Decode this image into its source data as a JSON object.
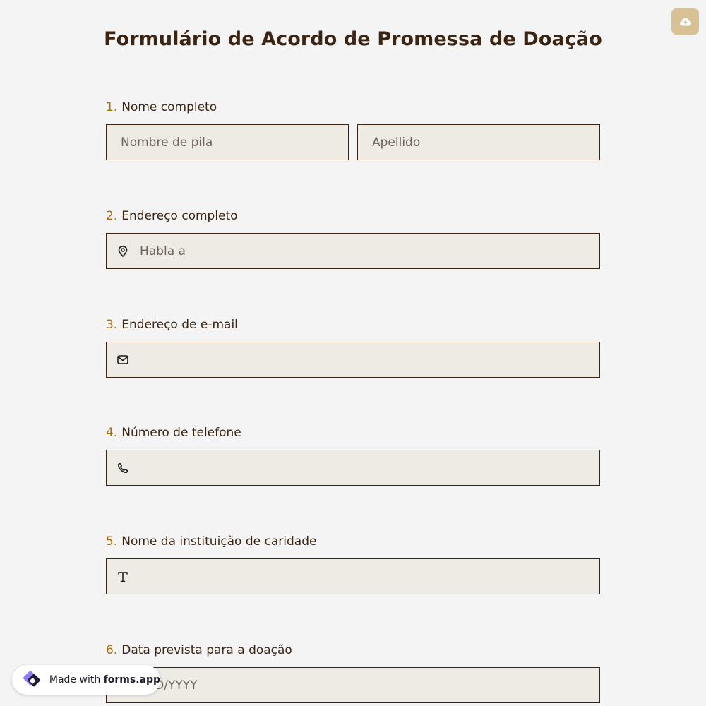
{
  "form": {
    "title": "Formulário de Acordo de Promessa de Doação"
  },
  "questions": [
    {
      "number": "1.",
      "label": "Nome completo",
      "first_placeholder": "Nombre de pila",
      "last_placeholder": "Apellido"
    },
    {
      "number": "2.",
      "label": "Endereço completo",
      "placeholder": "Habla a",
      "icon": "map-pin-icon"
    },
    {
      "number": "3.",
      "label": "Endereço de e-mail",
      "placeholder": "",
      "icon": "envelope-icon"
    },
    {
      "number": "4.",
      "label": "Número de telefone",
      "placeholder": "",
      "icon": "phone-icon"
    },
    {
      "number": "5.",
      "label": "Nome da instituição de caridade",
      "placeholder": "",
      "icon": "text-t-icon"
    },
    {
      "number": "6.",
      "label": "Data prevista para a doação",
      "placeholder": "MM/DD/YYYY"
    }
  ],
  "badge": {
    "prefix": "Made with",
    "brand": "forms.app"
  },
  "colors": {
    "title": "#3b2512",
    "number": "#a86d12",
    "field_bg": "#eeebe5",
    "save_button": "#d8c295",
    "background": "#f4f4f4"
  }
}
